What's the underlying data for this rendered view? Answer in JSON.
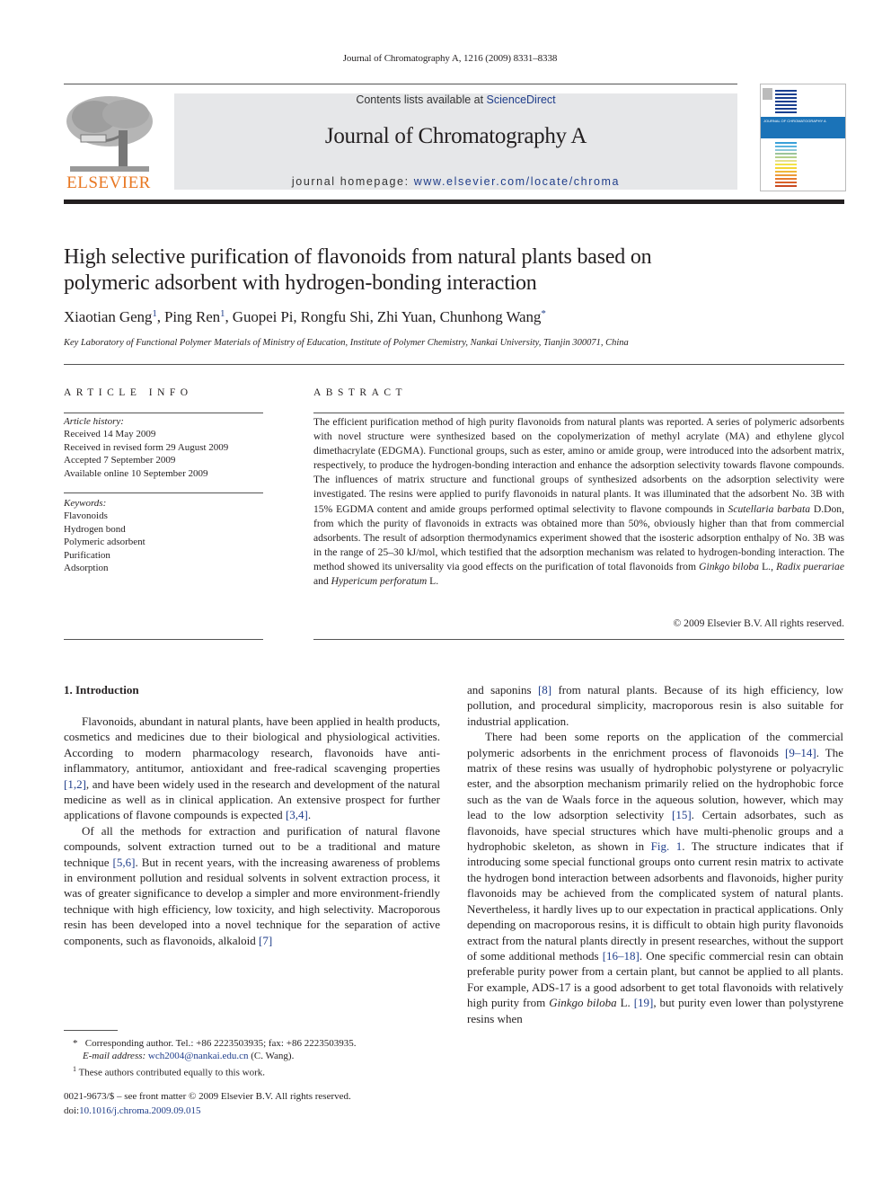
{
  "running_head": "Journal of Chromatography A, 1216 (2009) 8331–8338",
  "masthead": {
    "publisher_logo_text": "ELSEVIER",
    "contents_prefix": "Contents lists available at ",
    "contents_link": "ScienceDirect",
    "journal_title": "Journal of Chromatography A",
    "homepage_prefix": "journal homepage: ",
    "homepage_link": "www.elsevier.com/locate/chroma",
    "cover_title": "JOURNAL OF CHROMATOGRAPHY A"
  },
  "article": {
    "title_line1": "High selective purification of flavonoids from natural plants based on",
    "title_line2": "polymeric adsorbent with hydrogen-bonding interaction",
    "authors": [
      {
        "name": "Xiaotian Geng",
        "mark": "1",
        "sep": ", "
      },
      {
        "name": "Ping Ren",
        "mark": "1",
        "sep": ", "
      },
      {
        "name": "Guopei Pi",
        "mark": "",
        "sep": ", "
      },
      {
        "name": "Rongfu Shi",
        "mark": "",
        "sep": ", "
      },
      {
        "name": "Zhi Yuan",
        "mark": "",
        "sep": ", "
      },
      {
        "name": "Chunhong Wang",
        "mark": "*",
        "sep": ""
      }
    ],
    "affiliation": "Key Laboratory of Functional Polymer Materials of Ministry of Education, Institute of Polymer Chemistry, Nankai University, Tianjin 300071, China"
  },
  "article_info": {
    "heading": "ARTICLE INFO",
    "history_label": "Article history:",
    "history": [
      "Received 14 May 2009",
      "Received in revised form 29 August 2009",
      "Accepted 7 September 2009",
      "Available online 10 September 2009"
    ],
    "keywords_label": "Keywords:",
    "keywords": [
      "Flavonoids",
      "Hydrogen bond",
      "Polymeric adsorbent",
      "Purification",
      "Adsorption"
    ]
  },
  "abstract": {
    "heading": "ABSTRACT",
    "p1": "The efficient purification method of high purity flavonoids from natural plants was reported. A series of polymeric adsorbents with novel structure were synthesized based on the copolymerization of methyl acrylate (MA) and ethylene glycol dimethacrylate (EDGMA). Functional groups, such as ester, amino or amide group, were introduced into the adsorbent matrix, respectively, to produce the hydrogen-bonding interaction and enhance the adsorption selectivity towards flavone compounds. The influences of matrix structure and functional groups of synthesized adsorbents on the adsorption selectivity were investigated. The resins were applied to purify flavonoids in natural plants. It was illuminated that the adsorbent No. 3B with 15% EGDMA content and amide groups performed optimal selectivity to flavone compounds in ",
    "species1": "Scutellaria barbata",
    "p2": " D.Don, from which the purity of flavonoids in extracts was obtained more than 50%, obviously higher than that from commercial adsorbents. The result of adsorption thermodynamics experiment showed that the isosteric adsorption enthalpy of No. 3B was in the range of 25–30 kJ/mol, which testified that the adsorption mechanism was related to hydrogen-bonding interaction. The method showed its universality via good effects on the purification of total flavonoids from ",
    "species2": "Ginkgo biloba",
    "p3": " L., ",
    "species3": "Radix puerariae",
    "p4": " and ",
    "species4": "Hypericum perforatum",
    "p5": " L.",
    "copyright": "© 2009 Elsevier B.V. All rights reserved."
  },
  "intro": {
    "heading": "1.  Introduction",
    "left": {
      "p1a": "Flavonoids, abundant in natural plants, have been applied in health products, cosmetics and medicines due to their biological and physiological activities. According to modern pharmacology research, flavonoids have anti-inflammatory, antitumor, antioxidant and free-radical scavenging properties ",
      "ref1": "[1,2]",
      "p1b": ", and have been widely used in the research and development of the natural medicine as well as in clinical application. An extensive prospect for further applications of flavone compounds is expected ",
      "ref2": "[3,4]",
      "p1c": ".",
      "p2a": "Of all the methods for extraction and purification of natural flavone compounds, solvent extraction turned out to be a traditional and mature technique ",
      "ref3": "[5,6]",
      "p2b": ". But in recent years, with the increasing awareness of problems in environment pollution and residual solvents in solvent extraction process, it was of greater significance to develop a simpler and more environment-friendly technique with high efficiency, low toxicity, and high selectivity. Macroporous resin has been developed into a novel technique for the separation of active components, such as flavonoids, alkaloid ",
      "ref4": "[7]"
    },
    "right": {
      "p1a": "and saponins ",
      "ref1": "[8]",
      "p1b": " from natural plants. Because of its high efficiency, low pollution, and procedural simplicity, macroporous resin is also suitable for industrial application.",
      "p2a": "There had been some reports on the application of the commercial polymeric adsorbents in the enrichment process of flavonoids ",
      "ref2": "[9–14]",
      "p2b": ". The matrix of these resins was usually of hydrophobic polystyrene or polyacrylic ester, and the absorption mechanism primarily relied on the hydrophobic force such as the van de Waals force in the aqueous solution, however, which may lead to the low adsorption selectivity ",
      "ref3": "[15]",
      "p2c": ". Certain adsorbates, such as flavonoids, have special structures which have multi-phenolic groups and a hydrophobic skeleton, as shown in ",
      "fig": "Fig. 1",
      "p2d": ". The structure indicates that if introducing some special functional groups onto current resin matrix to activate the hydrogen bond interaction between adsorbents and flavonoids, higher purity flavonoids may be achieved from the complicated system of natural plants. Nevertheless, it hardly lives up to our expectation in practical applications. Only depending on macroporous resins, it is difficult to obtain high purity flavonoids extract from the natural plants directly in present researches, without the support of some additional methods ",
      "ref4": "[16–18]",
      "p2e": ". One specific commercial resin can obtain preferable purity power from a certain plant, but cannot be applied to all plants. For example, ADS-17 is a good adsorbent to get total flavonoids with relatively high purity from ",
      "species": "Ginkgo biloba",
      "p2f": " L. ",
      "ref5": "[19]",
      "p2g": ", but purity even lower than polystyrene resins when"
    }
  },
  "footnotes": {
    "corr_mark": "*",
    "corr_text": "Corresponding author. Tel.: +86 2223503935; fax: +86 2223503935.",
    "email_label": "E-mail address:",
    "email": "wch2004@nankai.edu.cn",
    "email_suffix": " (C. Wang).",
    "equal_mark": "1",
    "equal_text": "These authors contributed equally to this work."
  },
  "front_matter": {
    "issn_line": "0021-9673/$ – see front matter © 2009 Elsevier B.V. All rights reserved.",
    "doi_prefix": "doi:",
    "doi": "10.1016/j.chroma.2009.09.015"
  },
  "colors": {
    "link": "#1f3d8a",
    "elsevier_orange": "#e87722",
    "banner_bg": "#e6e7e9"
  }
}
